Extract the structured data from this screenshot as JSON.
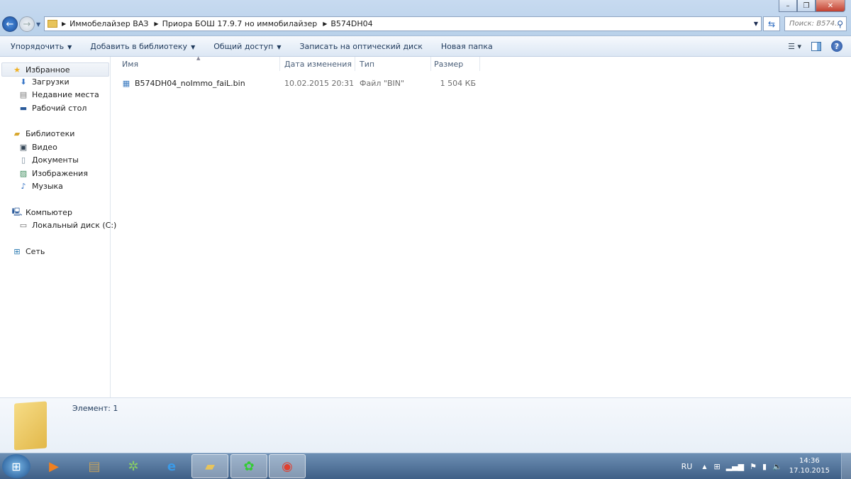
{
  "window": {
    "minimize": "–",
    "maximize": "❐",
    "close": "✕"
  },
  "address": {
    "crumbs": [
      "Иммобелайзер ВАЗ",
      "Приора БОШ 17.9.7 но иммобилайзер",
      "B574DH04"
    ],
    "search_placeholder": "Поиск: B574..."
  },
  "toolbar": {
    "organize": "Упорядочить",
    "add_library": "Добавить в библиотеку",
    "share": "Общий доступ",
    "burn": "Записать на оптический диск",
    "new_folder": "Новая папка"
  },
  "sidebar": {
    "favorites": "Избранное",
    "downloads": "Загрузки",
    "recent": "Недавние места",
    "desktop": "Рабочий стол",
    "libraries": "Библиотеки",
    "video": "Видео",
    "documents": "Документы",
    "images": "Изображения",
    "music": "Музыка",
    "computer": "Компьютер",
    "local_disk": "Локальный диск (C:)",
    "network": "Сеть"
  },
  "columns": {
    "name": "Имя",
    "date": "Дата изменения",
    "type": "Тип",
    "size": "Размер"
  },
  "files": [
    {
      "name": "B574DH04_noImmo_faiL.bin",
      "date": "10.02.2015 20:31",
      "type": "Файл \"BIN\"",
      "size": "1 504 КБ"
    }
  ],
  "details": {
    "count": "Элемент: 1"
  },
  "tray": {
    "lang": "RU",
    "time": "14:36",
    "date": "17.10.2015"
  }
}
